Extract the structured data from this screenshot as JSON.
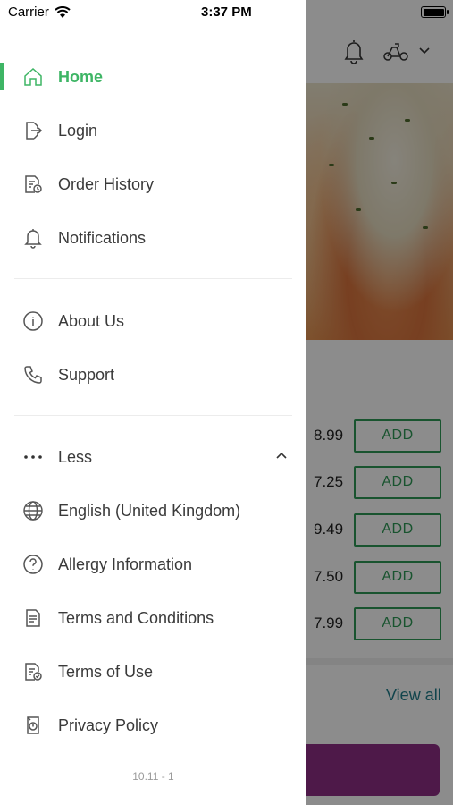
{
  "status_bar": {
    "carrier": "Carrier",
    "time": "3:37 PM",
    "wifi_icon": "wifi-icon",
    "battery_icon": "battery-icon"
  },
  "drawer": {
    "active_color": "#3eb565",
    "section_main": [
      {
        "label": "Home",
        "icon": "home-icon",
        "active": true
      },
      {
        "label": "Login",
        "icon": "login-icon"
      },
      {
        "label": "Order History",
        "icon": "order-history-icon"
      },
      {
        "label": "Notifications",
        "icon": "bell-icon"
      }
    ],
    "section_info": [
      {
        "label": "About Us",
        "icon": "info-icon"
      },
      {
        "label": "Support",
        "icon": "phone-icon"
      }
    ],
    "section_more": {
      "toggle_label": "Less",
      "toggle_icon": "more-dots-icon",
      "chevron_icon": "chevron-up-icon",
      "items": [
        {
          "label": "English (United Kingdom)",
          "icon": "globe-icon"
        },
        {
          "label": "Allergy Information",
          "icon": "question-icon"
        },
        {
          "label": "Terms and Conditions",
          "icon": "document-icon"
        },
        {
          "label": "Terms of Use",
          "icon": "document-check-icon"
        },
        {
          "label": "Privacy Policy",
          "icon": "privacy-icon"
        }
      ]
    },
    "version": "10.11 - 1"
  },
  "background": {
    "header_icons": [
      "bell-icon",
      "scooter-icon",
      "chevron-down-icon"
    ],
    "prices": [
      "8.99",
      "7.25",
      "9.49",
      "7.50",
      "7.99"
    ],
    "add_label": "ADD",
    "view_all": "View all",
    "accent_green": "#2e9a57",
    "cta_color": "#8e2f86"
  }
}
